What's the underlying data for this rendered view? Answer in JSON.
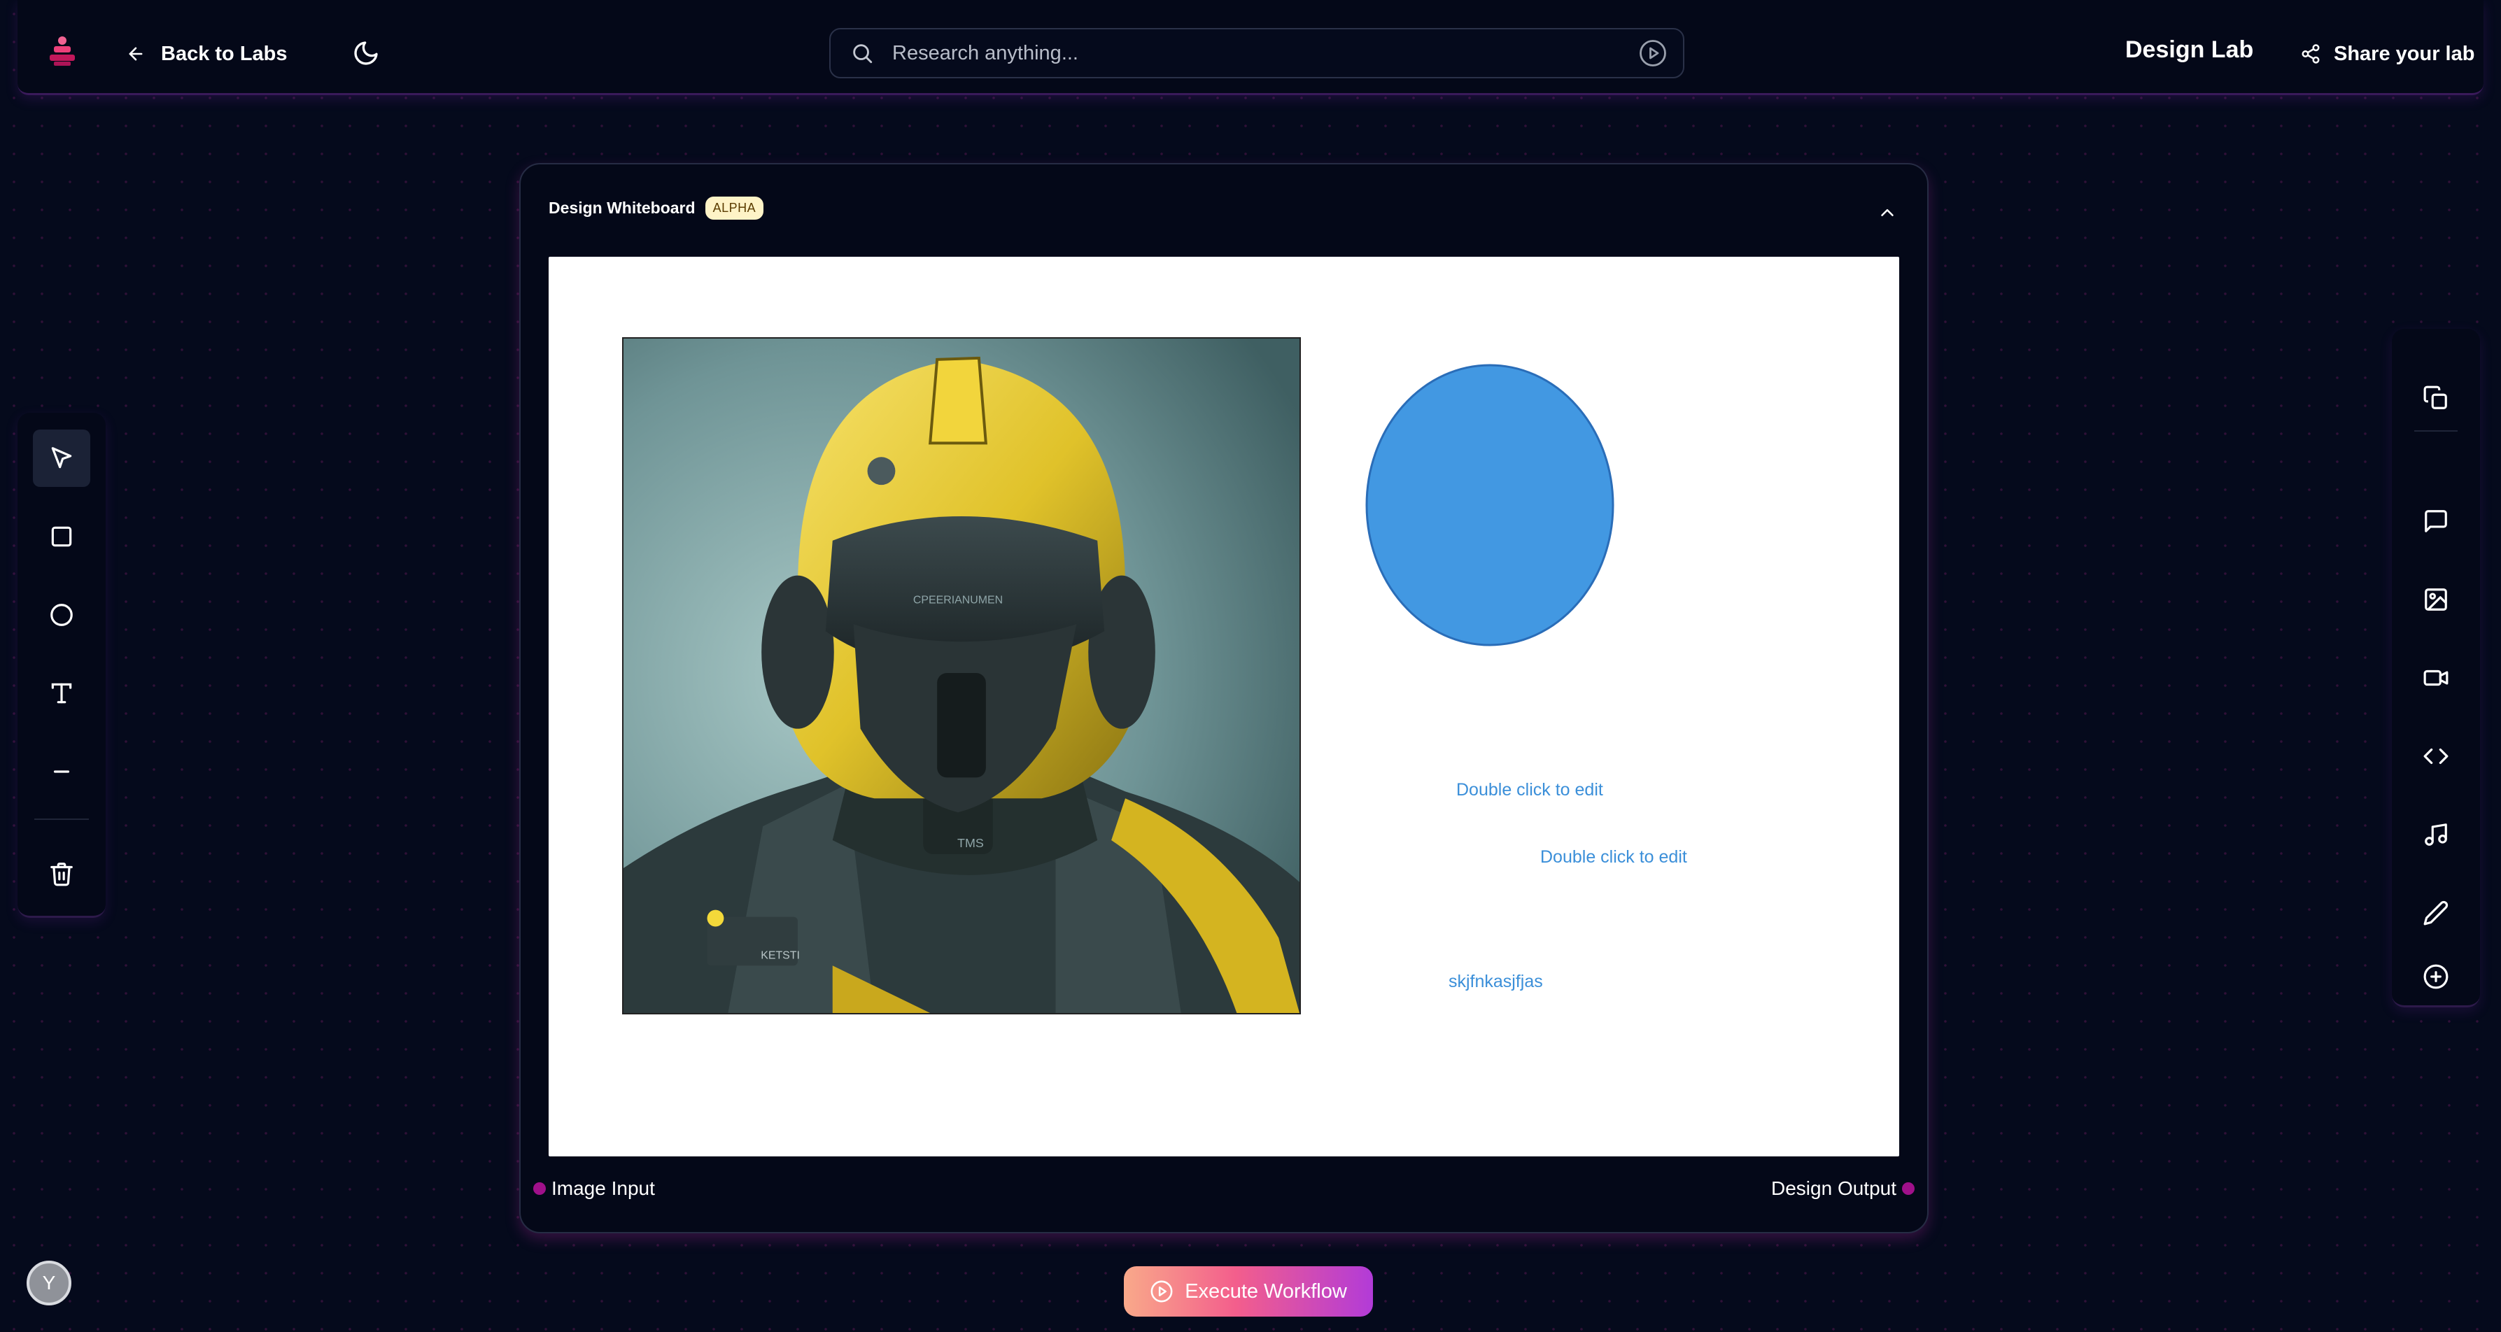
{
  "header": {
    "back_label": "Back to Labs",
    "search_placeholder": "Research anything...",
    "lab_title": "Design Lab",
    "share_label": "Share your lab"
  },
  "left_toolbar": {
    "tools": [
      "select-pointer-icon",
      "rectangle-icon",
      "circle-icon",
      "text-icon",
      "line-icon",
      "trash-icon"
    ],
    "active_tool": "select-pointer-icon"
  },
  "right_toolbar": {
    "tools": [
      "copy-icon",
      "comment-icon",
      "image-icon",
      "video-icon",
      "code-icon",
      "music-icon",
      "pen-icon",
      "add-circle-icon"
    ]
  },
  "whiteboard": {
    "title": "Design Whiteboard",
    "badge": "ALPHA",
    "canvas_texts": [
      "Double click to edit",
      "Double click to edit",
      "skjfnkasjfjas"
    ],
    "ellipse_color": "#4298e2",
    "text_color": "#3b8fd9",
    "image_visor_text": "CPEERIANUMEN",
    "image_chest_text": "TMS",
    "image_shoulder_text": "KETSTI",
    "input_port": "Image Input",
    "output_port": "Design Output"
  },
  "execute_label": "Execute Workflow",
  "user": {
    "avatar_initial": "Y"
  },
  "colors": {
    "background": "#050a1c",
    "port": "#a0108a",
    "badge_bg": "#fef3c7",
    "execute_gradient": [
      "#f9a98a",
      "#f35e8c",
      "#b23bd8"
    ]
  }
}
